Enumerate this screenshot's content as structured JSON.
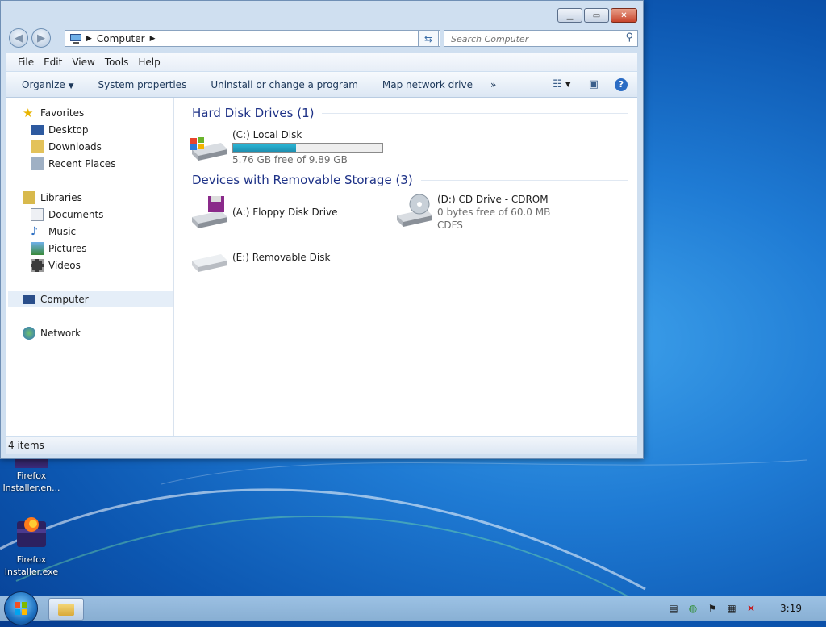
{
  "window": {
    "title": "Computer"
  },
  "address": {
    "location": "Computer"
  },
  "search": {
    "placeholder": "Search Computer"
  },
  "menu": [
    "File",
    "Edit",
    "View",
    "Tools",
    "Help"
  ],
  "toolbar": {
    "organize": "Organize",
    "system_properties": "System properties",
    "uninstall": "Uninstall or change a program",
    "map_drive": "Map network drive",
    "more": "»"
  },
  "sidebar": {
    "favorites": "Favorites",
    "desktop": "Desktop",
    "downloads": "Downloads",
    "recent": "Recent Places",
    "libraries": "Libraries",
    "documents": "Documents",
    "music": "Music",
    "pictures": "Pictures",
    "videos": "Videos",
    "computer": "Computer",
    "network": "Network"
  },
  "groups": {
    "hdd": "Hard Disk Drives (1)",
    "removable": "Devices with Removable Storage (3)"
  },
  "drives": {
    "c": {
      "name": "(C:) Local Disk",
      "free": "5.76 GB free of 9.89 GB",
      "used_fraction": 0.42
    },
    "a": {
      "name": "(A:) Floppy Disk Drive"
    },
    "d": {
      "name": "(D:) CD Drive - CDROM",
      "free": "0 bytes free of 60.0 MB",
      "fs": "CDFS"
    },
    "e": {
      "name": "(E:) Removable Disk"
    }
  },
  "status": {
    "items": "4 items"
  },
  "desktop_icons": [
    {
      "label": "Firefox Installer.en..."
    },
    {
      "label": "Firefox Installer.exe"
    }
  ],
  "taskbar": {
    "clock": "3:19"
  }
}
